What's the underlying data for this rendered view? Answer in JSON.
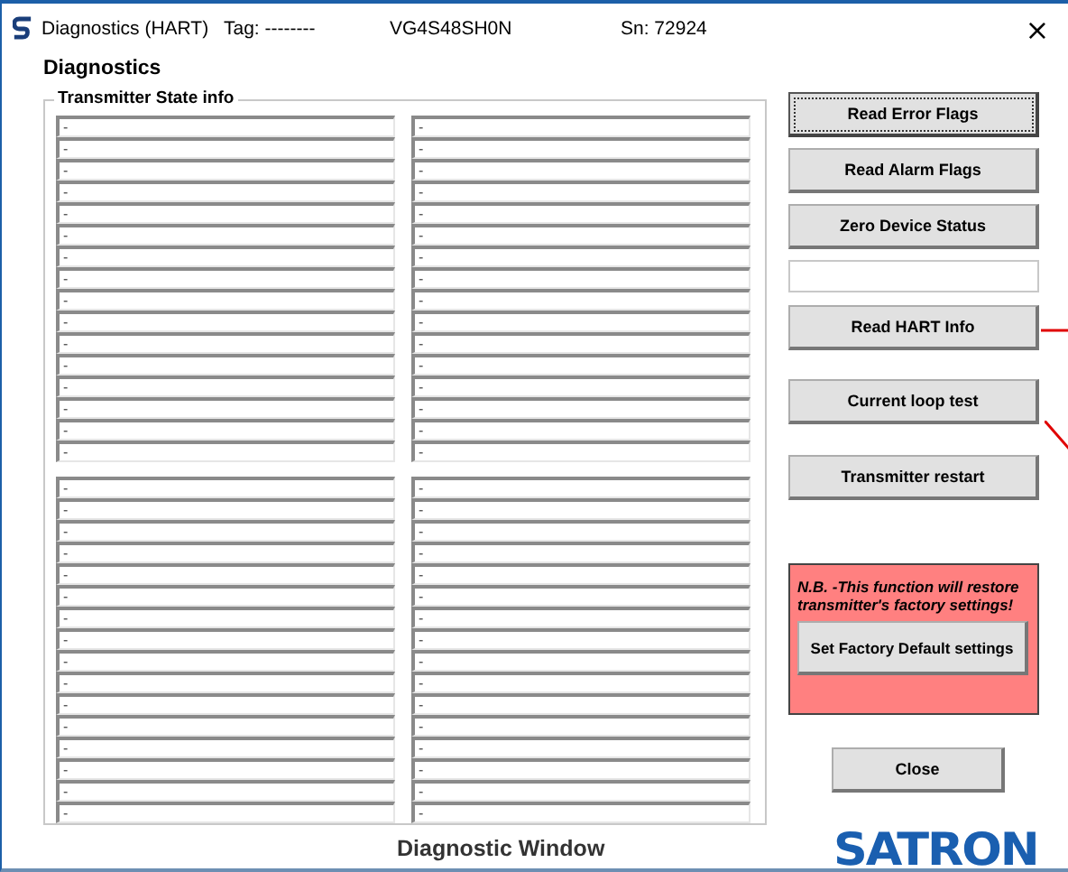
{
  "window": {
    "title": "Diagnostics (HART)",
    "tag": "Tag: --------",
    "device": "VG4S48SH0N",
    "serial": "Sn:  72924",
    "close": "×"
  },
  "heading": "Diagnostics",
  "state_info": {
    "legend": "Transmitter State info",
    "panels": [
      {
        "fields": [
          "-",
          "-",
          "-",
          "-",
          "-",
          "-",
          "-",
          "-",
          "-",
          "-",
          "-",
          "-",
          "-",
          "-",
          "-",
          "-"
        ]
      },
      {
        "fields": [
          "-",
          "-",
          "-",
          "-",
          "-",
          "-",
          "-",
          "-",
          "-",
          "-",
          "-",
          "-",
          "-",
          "-",
          "-",
          "-"
        ]
      },
      {
        "fields": [
          "-",
          "-",
          "-",
          "-",
          "-",
          "-",
          "-",
          "-",
          "-",
          "-",
          "-",
          "-",
          "-",
          "-",
          "-",
          "-"
        ]
      },
      {
        "fields": [
          "-",
          "-",
          "-",
          "-",
          "-",
          "-",
          "-",
          "-",
          "-",
          "-",
          "-",
          "-",
          "-",
          "-",
          "-",
          "-"
        ]
      }
    ]
  },
  "actions": [
    {
      "kind": "button",
      "label": "Read Error Flags",
      "focused": true
    },
    {
      "kind": "button",
      "label": "Read Alarm Flags",
      "focused": false
    },
    {
      "kind": "button",
      "label": "Zero Device Status",
      "focused": false
    },
    {
      "kind": "field"
    },
    {
      "kind": "button",
      "label": "Read HART Info",
      "focused": false
    },
    {
      "kind": "button",
      "label": "Current loop test",
      "focused": false
    },
    {
      "kind": "button",
      "label": "Transmitter restart",
      "focused": false
    }
  ],
  "warning": {
    "text": "N.B. -This function will restore transmitter's factory settings!",
    "button": "Set Factory Default settings"
  },
  "close_button": "Close",
  "footer": "Diagnostic Window",
  "logo": "SATRON"
}
